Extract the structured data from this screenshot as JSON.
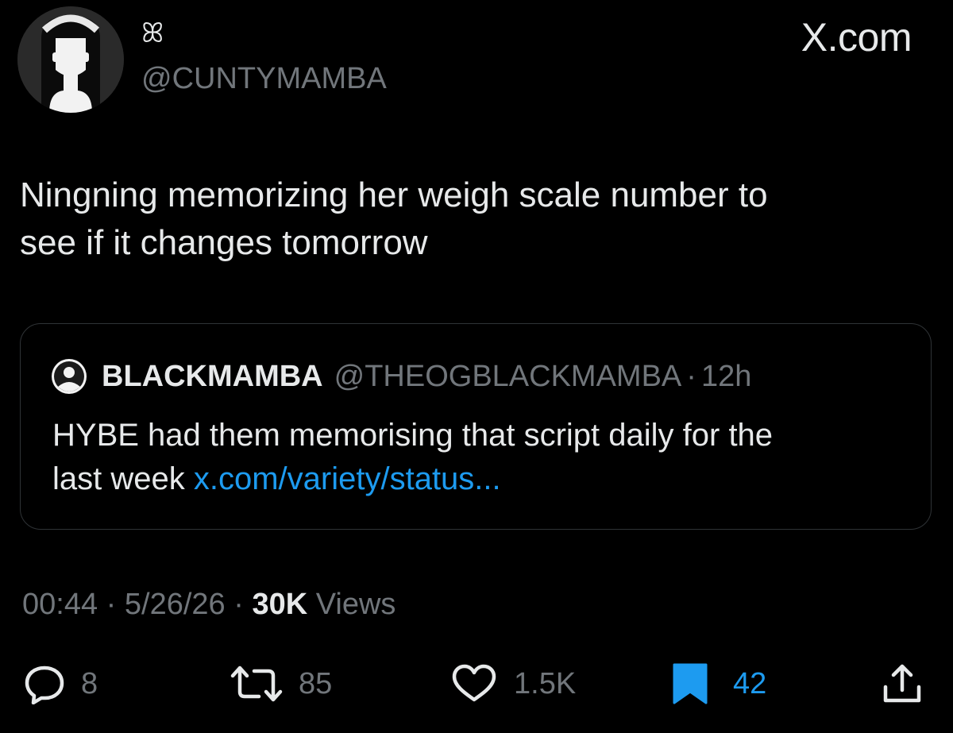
{
  "author": {
    "display_name": "ꕤ",
    "handle": "@CUNTYMAMBA"
  },
  "brand": "X.com",
  "tweet": {
    "line1": "Ningning memorizing her weigh scale number to",
    "line2": "see if it changes tomorrow"
  },
  "quoted": {
    "name": "BLACKMAMBA",
    "handle": "@THEOGBLACKMAMBA",
    "separator": "·",
    "time": "12h",
    "line1": "HYBE had them memorising that script daily for the",
    "line2_text": "last week ",
    "link": "x.com/variety/status..."
  },
  "meta": {
    "time": "00:44",
    "sep": "·",
    "date": "5/26/26",
    "views_count": "30K",
    "views_label": "Views"
  },
  "actions": {
    "replies": "8",
    "reposts": "85",
    "likes": "1.5K",
    "bookmarks": "42"
  },
  "colors": {
    "background": "#000000",
    "text": "#e7e9ea",
    "muted": "#71767b",
    "link": "#1d9bf0",
    "bookmark_active": "#1d9bf0",
    "quote_border": "#2f3336"
  }
}
